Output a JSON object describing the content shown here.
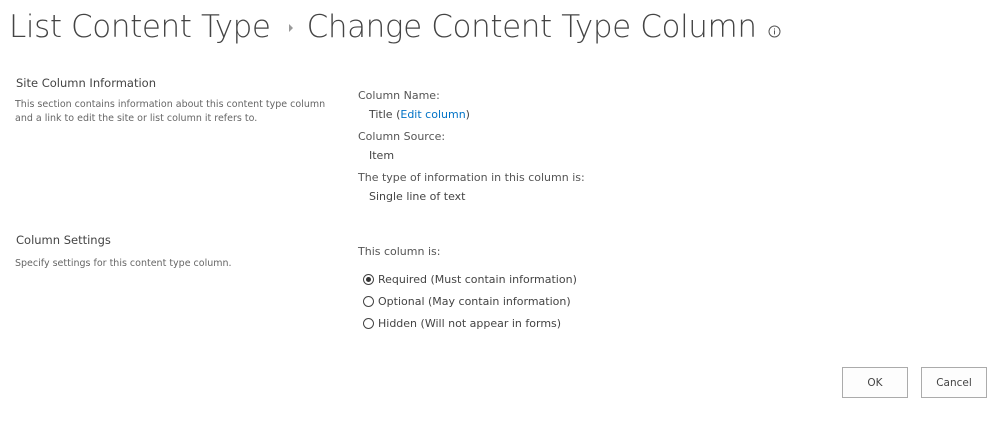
{
  "header": {
    "breadcrumb_parent": "List Content Type",
    "page_title": "Change Content Type Column",
    "info_icon": "info-circle-icon"
  },
  "site_column_info": {
    "title": "Site Column Information",
    "description": "This section contains information about this content type column and a link to edit the site or list column it refers to.",
    "column_name_label": "Column Name:",
    "column_name_value": "Title",
    "edit_link_open": " (",
    "edit_link_label": "Edit column",
    "edit_link_close": ")",
    "column_source_label": "Column Source:",
    "column_source_value": "Item",
    "type_label": "The type of information in this column is:",
    "type_value": "Single line of text"
  },
  "column_settings": {
    "title": "Column Settings",
    "description": "Specify settings for this content type column.",
    "prompt": "This column is:",
    "options": [
      {
        "label": "Required (Must contain information)",
        "checked": true
      },
      {
        "label": "Optional (May contain information)",
        "checked": false
      },
      {
        "label": "Hidden (Will not appear in forms)",
        "checked": false
      }
    ]
  },
  "buttons": {
    "ok": "OK",
    "cancel": "Cancel"
  }
}
